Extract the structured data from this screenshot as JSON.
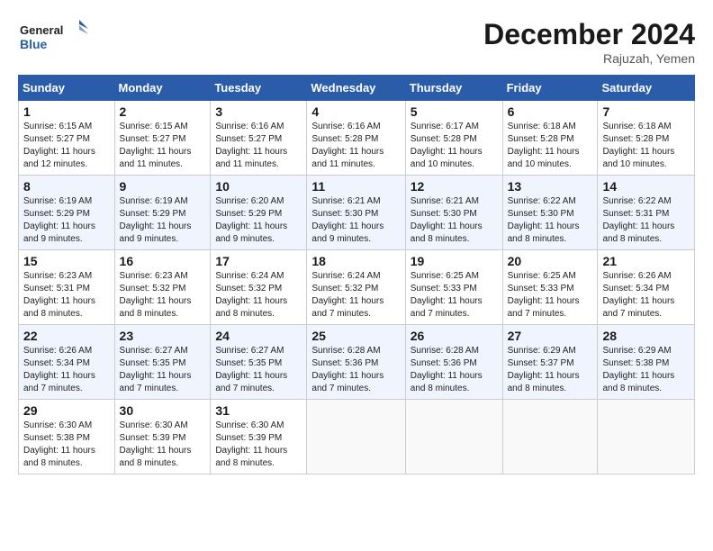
{
  "logo": {
    "line1": "General",
    "line2": "Blue"
  },
  "title": {
    "month_year": "December 2024",
    "location": "Rajuzah, Yemen"
  },
  "headers": [
    "Sunday",
    "Monday",
    "Tuesday",
    "Wednesday",
    "Thursday",
    "Friday",
    "Saturday"
  ],
  "weeks": [
    [
      {
        "day": "1",
        "sunrise": "Sunrise: 6:15 AM",
        "sunset": "Sunset: 5:27 PM",
        "daylight": "Daylight: 11 hours and 12 minutes."
      },
      {
        "day": "2",
        "sunrise": "Sunrise: 6:15 AM",
        "sunset": "Sunset: 5:27 PM",
        "daylight": "Daylight: 11 hours and 11 minutes."
      },
      {
        "day": "3",
        "sunrise": "Sunrise: 6:16 AM",
        "sunset": "Sunset: 5:27 PM",
        "daylight": "Daylight: 11 hours and 11 minutes."
      },
      {
        "day": "4",
        "sunrise": "Sunrise: 6:16 AM",
        "sunset": "Sunset: 5:28 PM",
        "daylight": "Daylight: 11 hours and 11 minutes."
      },
      {
        "day": "5",
        "sunrise": "Sunrise: 6:17 AM",
        "sunset": "Sunset: 5:28 PM",
        "daylight": "Daylight: 11 hours and 10 minutes."
      },
      {
        "day": "6",
        "sunrise": "Sunrise: 6:18 AM",
        "sunset": "Sunset: 5:28 PM",
        "daylight": "Daylight: 11 hours and 10 minutes."
      },
      {
        "day": "7",
        "sunrise": "Sunrise: 6:18 AM",
        "sunset": "Sunset: 5:28 PM",
        "daylight": "Daylight: 11 hours and 10 minutes."
      }
    ],
    [
      {
        "day": "8",
        "sunrise": "Sunrise: 6:19 AM",
        "sunset": "Sunset: 5:29 PM",
        "daylight": "Daylight: 11 hours and 9 minutes."
      },
      {
        "day": "9",
        "sunrise": "Sunrise: 6:19 AM",
        "sunset": "Sunset: 5:29 PM",
        "daylight": "Daylight: 11 hours and 9 minutes."
      },
      {
        "day": "10",
        "sunrise": "Sunrise: 6:20 AM",
        "sunset": "Sunset: 5:29 PM",
        "daylight": "Daylight: 11 hours and 9 minutes."
      },
      {
        "day": "11",
        "sunrise": "Sunrise: 6:21 AM",
        "sunset": "Sunset: 5:30 PM",
        "daylight": "Daylight: 11 hours and 9 minutes."
      },
      {
        "day": "12",
        "sunrise": "Sunrise: 6:21 AM",
        "sunset": "Sunset: 5:30 PM",
        "daylight": "Daylight: 11 hours and 8 minutes."
      },
      {
        "day": "13",
        "sunrise": "Sunrise: 6:22 AM",
        "sunset": "Sunset: 5:30 PM",
        "daylight": "Daylight: 11 hours and 8 minutes."
      },
      {
        "day": "14",
        "sunrise": "Sunrise: 6:22 AM",
        "sunset": "Sunset: 5:31 PM",
        "daylight": "Daylight: 11 hours and 8 minutes."
      }
    ],
    [
      {
        "day": "15",
        "sunrise": "Sunrise: 6:23 AM",
        "sunset": "Sunset: 5:31 PM",
        "daylight": "Daylight: 11 hours and 8 minutes."
      },
      {
        "day": "16",
        "sunrise": "Sunrise: 6:23 AM",
        "sunset": "Sunset: 5:32 PM",
        "daylight": "Daylight: 11 hours and 8 minutes."
      },
      {
        "day": "17",
        "sunrise": "Sunrise: 6:24 AM",
        "sunset": "Sunset: 5:32 PM",
        "daylight": "Daylight: 11 hours and 8 minutes."
      },
      {
        "day": "18",
        "sunrise": "Sunrise: 6:24 AM",
        "sunset": "Sunset: 5:32 PM",
        "daylight": "Daylight: 11 hours and 7 minutes."
      },
      {
        "day": "19",
        "sunrise": "Sunrise: 6:25 AM",
        "sunset": "Sunset: 5:33 PM",
        "daylight": "Daylight: 11 hours and 7 minutes."
      },
      {
        "day": "20",
        "sunrise": "Sunrise: 6:25 AM",
        "sunset": "Sunset: 5:33 PM",
        "daylight": "Daylight: 11 hours and 7 minutes."
      },
      {
        "day": "21",
        "sunrise": "Sunrise: 6:26 AM",
        "sunset": "Sunset: 5:34 PM",
        "daylight": "Daylight: 11 hours and 7 minutes."
      }
    ],
    [
      {
        "day": "22",
        "sunrise": "Sunrise: 6:26 AM",
        "sunset": "Sunset: 5:34 PM",
        "daylight": "Daylight: 11 hours and 7 minutes."
      },
      {
        "day": "23",
        "sunrise": "Sunrise: 6:27 AM",
        "sunset": "Sunset: 5:35 PM",
        "daylight": "Daylight: 11 hours and 7 minutes."
      },
      {
        "day": "24",
        "sunrise": "Sunrise: 6:27 AM",
        "sunset": "Sunset: 5:35 PM",
        "daylight": "Daylight: 11 hours and 7 minutes."
      },
      {
        "day": "25",
        "sunrise": "Sunrise: 6:28 AM",
        "sunset": "Sunset: 5:36 PM",
        "daylight": "Daylight: 11 hours and 7 minutes."
      },
      {
        "day": "26",
        "sunrise": "Sunrise: 6:28 AM",
        "sunset": "Sunset: 5:36 PM",
        "daylight": "Daylight: 11 hours and 8 minutes."
      },
      {
        "day": "27",
        "sunrise": "Sunrise: 6:29 AM",
        "sunset": "Sunset: 5:37 PM",
        "daylight": "Daylight: 11 hours and 8 minutes."
      },
      {
        "day": "28",
        "sunrise": "Sunrise: 6:29 AM",
        "sunset": "Sunset: 5:38 PM",
        "daylight": "Daylight: 11 hours and 8 minutes."
      }
    ],
    [
      {
        "day": "29",
        "sunrise": "Sunrise: 6:30 AM",
        "sunset": "Sunset: 5:38 PM",
        "daylight": "Daylight: 11 hours and 8 minutes."
      },
      {
        "day": "30",
        "sunrise": "Sunrise: 6:30 AM",
        "sunset": "Sunset: 5:39 PM",
        "daylight": "Daylight: 11 hours and 8 minutes."
      },
      {
        "day": "31",
        "sunrise": "Sunrise: 6:30 AM",
        "sunset": "Sunset: 5:39 PM",
        "daylight": "Daylight: 11 hours and 8 minutes."
      },
      null,
      null,
      null,
      null
    ]
  ]
}
